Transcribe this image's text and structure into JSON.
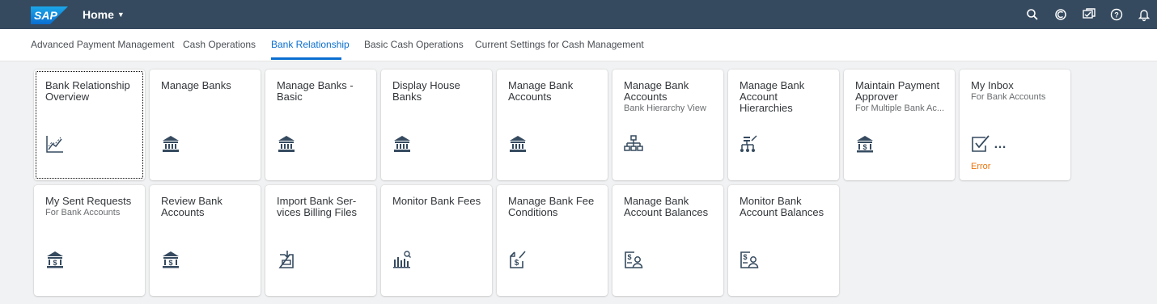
{
  "shell": {
    "logo_text": "SAP",
    "home_label": "Home",
    "icons": [
      "search-icon",
      "copilot-icon",
      "notifications-icon",
      "help-icon",
      "bell-icon"
    ]
  },
  "tabs": [
    {
      "label": "Advanced Payment Management"
    },
    {
      "label": "Cash Operations"
    },
    {
      "label": "Bank Relationship",
      "active": true
    },
    {
      "label": "Basic Cash Operations"
    },
    {
      "label": "Current Settings for Cash Management"
    }
  ],
  "tiles": [
    {
      "title": "Bank Relationship Overview",
      "subtitle": "",
      "icon": "analytics-icon",
      "status": ""
    },
    {
      "title": "Manage Banks",
      "subtitle": "",
      "icon": "bank-icon",
      "status": ""
    },
    {
      "title": "Manage Banks - Basic",
      "subtitle": "",
      "icon": "bank-icon",
      "status": ""
    },
    {
      "title": "Display House Banks",
      "subtitle": "",
      "icon": "bank-icon",
      "status": ""
    },
    {
      "title": "Manage Bank Accounts",
      "subtitle": "",
      "icon": "bank-icon",
      "status": ""
    },
    {
      "title": "Manage Bank Accounts",
      "subtitle": "Bank Hierarchy View",
      "icon": "hierarchy-icon",
      "status": ""
    },
    {
      "title": "Manage Bank Account Hierarchies",
      "subtitle": "",
      "icon": "org-chart-icon",
      "status": ""
    },
    {
      "title": "Maintain Payment Approver",
      "subtitle": "For Multiple Bank Ac...",
      "icon": "bank-dollar-icon",
      "status": ""
    },
    {
      "title": "My Inbox",
      "subtitle": "For Bank Accounts",
      "icon": "checkbox-icon",
      "status": "Error"
    },
    {
      "title": "My Sent Requests",
      "subtitle": "For Bank Accounts",
      "icon": "bank-dollar-icon",
      "status": ""
    },
    {
      "title": "Review Bank Accounts",
      "subtitle": "",
      "icon": "bank-dollar-icon",
      "status": ""
    },
    {
      "title": "Import Bank Ser-vices Billing Files",
      "subtitle": "",
      "icon": "import-document-icon",
      "status": ""
    },
    {
      "title": "Monitor Bank Fees",
      "subtitle": "",
      "icon": "bar-chart-search-icon",
      "status": ""
    },
    {
      "title": "Manage Bank Fee Conditions",
      "subtitle": "",
      "icon": "dollar-document-icon",
      "status": ""
    },
    {
      "title": "Manage Bank Account Balances",
      "subtitle": "",
      "icon": "balance-person-icon",
      "status": ""
    },
    {
      "title": "Monitor Bank Account Balances",
      "subtitle": "",
      "icon": "balance-person-icon",
      "status": ""
    }
  ]
}
